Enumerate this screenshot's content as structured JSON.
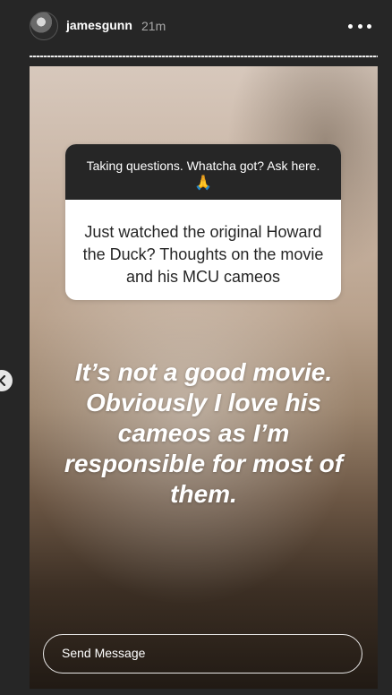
{
  "header": {
    "username": "jamesgunn",
    "time_ago": "21m",
    "more_icon": "more-horizontal-icon"
  },
  "story": {
    "question_sticker": {
      "prompt": "Taking questions. Whatcha got? Ask here.",
      "emoji": "🙏",
      "question": "Just watched the original Howard the Duck? Thoughts on the movie and his MCU cameos"
    },
    "answer_lines": [
      "It’s not a good movie.",
      "Obviously I love his",
      "cameos as I’m",
      "responsible for most of",
      "them."
    ],
    "reply": {
      "placeholder": "Send Message"
    }
  },
  "navigation": {
    "prev_icon": "chevron-left-icon"
  },
  "colors": {
    "background": "#262626",
    "sticker_header": "#262626",
    "sticker_body": "#ffffff"
  }
}
